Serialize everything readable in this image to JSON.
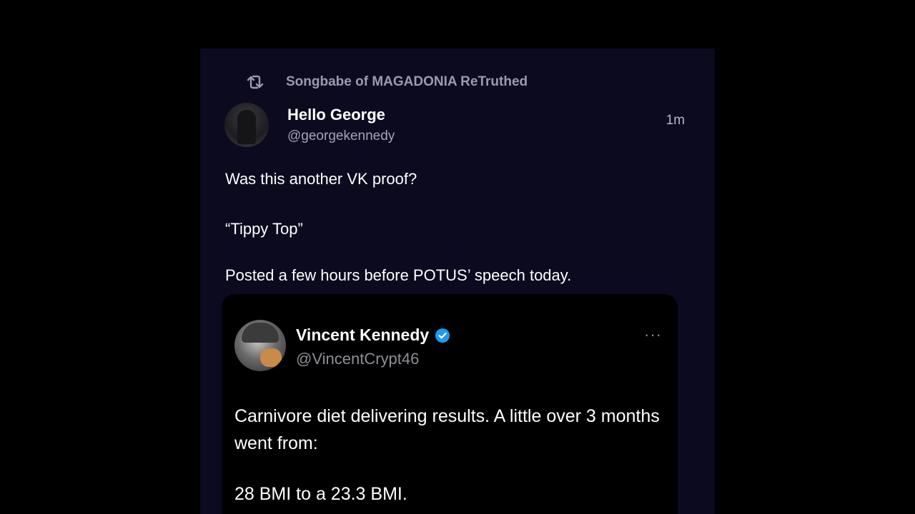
{
  "retruth": {
    "icon": "retruth-icon",
    "text": "Songbabe of MAGADONIA ReTruthed"
  },
  "post": {
    "author": {
      "display_name": "Hello George",
      "handle": "@georgekennedy",
      "avatar": "avatar"
    },
    "timestamp": "1m",
    "lines": [
      "Was this another VK proof?",
      "“Tippy Top”",
      "Posted a few hours before POTUS’ speech today."
    ]
  },
  "quote": {
    "author": {
      "display_name": "Vincent Kennedy",
      "handle": "@VincentCrypt46",
      "verified": true
    },
    "more": "···",
    "text": "Carnivore diet delivering results. A little over 3 months went from:",
    "text2": "28 BMI to a 23.3 BMI."
  },
  "colors": {
    "background": "#000000",
    "panel": "#0b0a1f",
    "verified_badge": "#1d9bf0"
  }
}
